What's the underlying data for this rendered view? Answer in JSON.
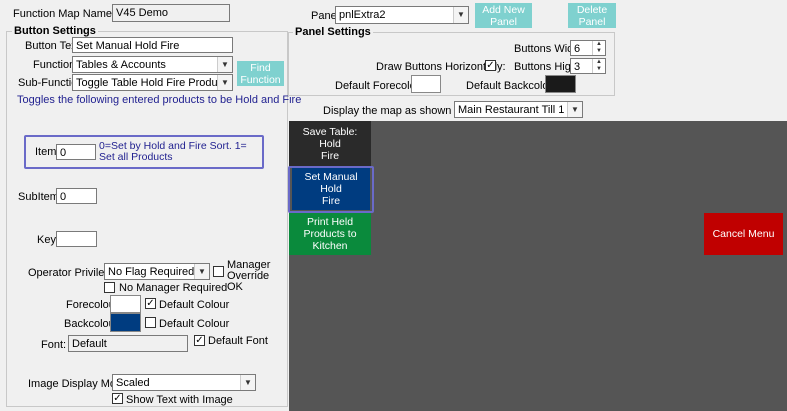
{
  "function_map": {
    "label": "Function Map Name:",
    "value": "V45 Demo"
  },
  "panel": {
    "label": "Panel",
    "value": "pnlExtra2",
    "add_label": "Add New Panel",
    "delete_label": "Delete Panel"
  },
  "button_settings": {
    "title": "Button Settings",
    "button_text_label": "Button Text",
    "button_text_value": "Set Manual Hold Fire",
    "function_label": "Function",
    "function_value": "Tables & Accounts",
    "sub_function_label": "Sub-Function",
    "sub_function_value": "Toggle Table Hold Fire Products",
    "find_function_label": "Find Function",
    "description": "Toggles the following entered products to be Hold and Fire",
    "item_label": "Item",
    "item_value": "0",
    "item_hint": "0=Set by Hold and Fire Sort. 1= Set all Products",
    "subitem_label": "SubItem",
    "subitem_value": "0",
    "key_label": "Key",
    "key_value": "",
    "operator_privilege_label": "Operator Privilege:",
    "operator_privilege_value": "No Flag Required",
    "manager_override_label": "Manager Override OK",
    "manager_override_checked": false,
    "no_manager_required_label": "No Manager Required",
    "no_manager_required_checked": false,
    "forecolour_label": "Forecolour",
    "forecolour_color": "#ffffff",
    "forecolour_default_label": "Default Colour",
    "forecolour_default_checked": true,
    "backcolour_label": "Backcolour",
    "backcolour_color": "#003c80",
    "backcolour_default_label": "Default Colour",
    "backcolour_default_checked": false,
    "font_label": "Font:",
    "font_value": "Default",
    "default_font_label": "Default Font",
    "default_font_checked": true,
    "image_display_mode_label": "Image Display Mode:",
    "image_display_mode_value": "Scaled",
    "show_text_with_image_label": "Show Text with Image",
    "show_text_with_image_checked": true
  },
  "panel_settings": {
    "title": "Panel Settings",
    "buttons_wide_label": "Buttons Wide:",
    "buttons_wide_value": "6",
    "draw_horizontally_label": "Draw Buttons Horizontally:",
    "draw_horizontally_checked": true,
    "buttons_high_label": "Buttons High:",
    "buttons_high_value": "3",
    "default_forecolour_label": "Default Forecolour",
    "default_forecolour_color": "#ffffff",
    "default_backcolour_label": "Default Backcolour",
    "default_backcolour_color": "#1a1a1a"
  },
  "map_display": {
    "label": "Display the map as shown on till:",
    "value": "Main Restaurant Till 1"
  },
  "map_buttons": [
    {
      "label": "Save Table:\nHold\nFire",
      "color": "#2a2a2a"
    },
    {
      "label": "Set Manual\nHold\nFire",
      "color": "#003c80"
    },
    {
      "label": "Print Held\nProducts to\nKitchen",
      "color": "#0a8a3c"
    },
    {
      "label": "Cancel Menu",
      "color": "#c00000"
    }
  ],
  "colors": {
    "teal": "#7fd1cf",
    "map_bg": "#555555",
    "highlight": "#6a6ac8"
  }
}
